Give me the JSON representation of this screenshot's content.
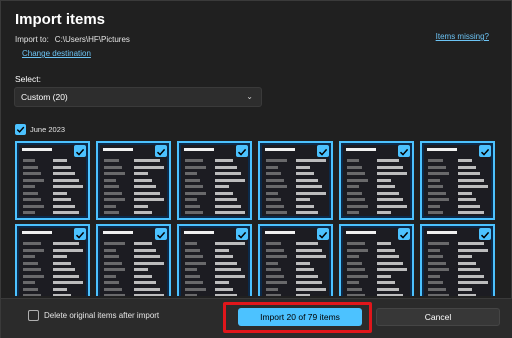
{
  "dialog": {
    "title": "Import items",
    "import_to_label": "Import to:",
    "import_to_path": "C:\\Users\\HF\\Pictures",
    "change_destination": "Change destination",
    "items_missing": "Items missing?"
  },
  "select": {
    "label": "Select:",
    "value": "Custom (20)"
  },
  "group": {
    "label": "June 2023",
    "checked": true
  },
  "thumbnails": {
    "count": 12,
    "all_selected": true
  },
  "footer": {
    "delete_label": "Delete original items after import",
    "delete_checked": false,
    "import_button": "Import 20 of 79 items",
    "cancel_button": "Cancel"
  },
  "colors": {
    "accent": "#4cc2ff",
    "highlight": "#e0161b",
    "background": "#202020"
  }
}
